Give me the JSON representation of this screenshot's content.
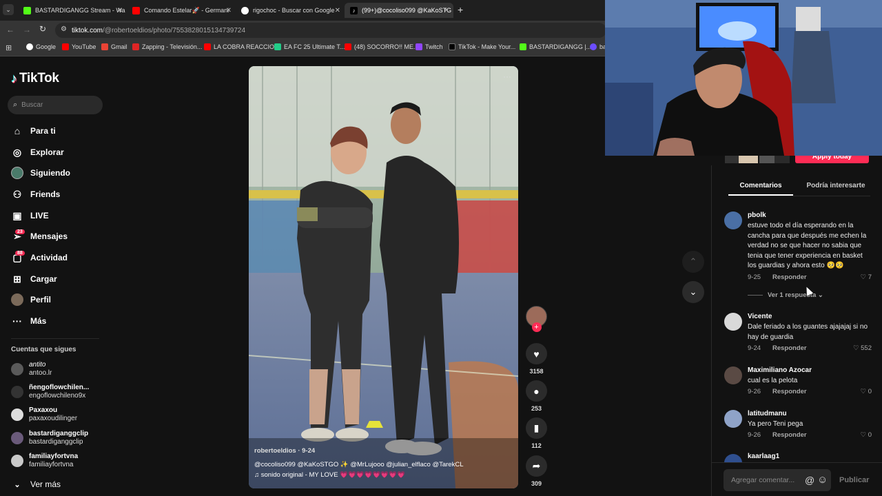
{
  "browser": {
    "tabs": [
      {
        "title": "BASTARDIGANGG Stream - Wa",
        "color": "#53fc18"
      },
      {
        "title": "Comando Estelar🚀 - Germani",
        "color": "#ff0000"
      },
      {
        "title": "rigochoc - Buscar con Google",
        "color": "#4285f4"
      },
      {
        "title": "(99+)@cocoliso099 @KaKoSTG",
        "color": "#000000"
      }
    ],
    "new_tab": "+",
    "url_host": "tiktok.com",
    "url_path": "/@robertoeldios/photo/7553828015134739724",
    "bookmarks": [
      {
        "label": "Google",
        "color": "#4285f4"
      },
      {
        "label": "YouTube",
        "color": "#ff0000"
      },
      {
        "label": "Gmail",
        "color": "#ea4335"
      },
      {
        "label": "Zapping - Televisión...",
        "color": "#e02525"
      },
      {
        "label": "LA COBRA REACCIO...",
        "color": "#ff0000"
      },
      {
        "label": "EA FC 25 Ultimate T...",
        "color": "#22cc88"
      },
      {
        "label": "(48) SOCORRO!! ME...",
        "color": "#ff0000"
      },
      {
        "label": "Twitch",
        "color": "#9146ff"
      },
      {
        "label": "TikTok - Make Your...",
        "color": "#000000"
      },
      {
        "label": "BASTARDIGANGG |...",
        "color": "#53fc18"
      },
      {
        "label": "ba",
        "color": "#6c4dff"
      }
    ]
  },
  "sidebar": {
    "logo": "TikTok",
    "search_placeholder": "Buscar",
    "nav": [
      {
        "label": "Para ti",
        "icon": "home-icon"
      },
      {
        "label": "Explorar",
        "icon": "compass-icon"
      },
      {
        "label": "Siguiendo",
        "icon": "following-avatar"
      },
      {
        "label": "Friends",
        "icon": "friends-icon"
      },
      {
        "label": "LIVE",
        "icon": "live-icon"
      },
      {
        "label": "Mensajes",
        "icon": "messages-icon",
        "badge": "23"
      },
      {
        "label": "Actividad",
        "icon": "activity-icon",
        "badge": "88"
      },
      {
        "label": "Cargar",
        "icon": "upload-icon"
      },
      {
        "label": "Perfil",
        "icon": "profile-avatar"
      },
      {
        "label": "Más",
        "icon": "more-icon"
      }
    ],
    "following_title": "Cuentas que sigues",
    "following": [
      {
        "name": "antito",
        "handle": "antoo.lr"
      },
      {
        "name": "ñengoflowchilen...",
        "handle": "engoflowchileno9x"
      },
      {
        "name": "Paxaxou",
        "handle": "paxaxoudilinger"
      },
      {
        "name": "bastardiganggclip",
        "handle": "bastardiganggclip"
      },
      {
        "name": "familiayfortvna",
        "handle": "familiayfortvna"
      }
    ],
    "see_more": "Ver más"
  },
  "video": {
    "author": "robertoeldios · 9-24",
    "mentions": "@cocoliso099  @KaKoSTGO ✨  @MrLujooo  @julian_elflaco  @TarekCL",
    "sound": "♫ sonido original - MY LOVE 💗💗💗💗💗💗💗💗",
    "more": "···"
  },
  "actions": {
    "likes": "3158",
    "comments": "253",
    "saves": "112",
    "shares": "309"
  },
  "panel": {
    "apply_button": "Apply today",
    "tab_comments": "Comentarios",
    "tab_interest": "Podría interesarte",
    "comments": [
      {
        "user": "pbolk",
        "text": "estuve todo el día esperando en la cancha para que después me echen la verdad no se que hacer no sabia que tenia que tener experiencia en basket los guardias y ahora esto 🥺🥺",
        "date": "9-25",
        "reply": "Responder",
        "likes": "7",
        "view_replies": "Ver 1 respuesta"
      },
      {
        "user": "Vicente",
        "text": "Dale feriado a los guantes ajajajaj si no hay de guardia",
        "date": "9-24",
        "reply": "Responder",
        "likes": "552"
      },
      {
        "user": "Maximiliano Azocar",
        "text": "cual es la pelota",
        "date": "9-26",
        "reply": "Responder",
        "likes": "0"
      },
      {
        "user": "latitudmanu",
        "text": "Ya pero Teni pega",
        "date": "9-26",
        "reply": "Responder",
        "likes": "0"
      },
      {
        "user": "kaarlaag1",
        "text": "",
        "date": "",
        "reply": "",
        "likes": ""
      }
    ],
    "add_comment_placeholder": "Agregar comentar...",
    "mention": "@",
    "emoji": "☺",
    "publish": "Publicar"
  },
  "colors": {
    "accent": "#fe2c55",
    "bg": "#121212"
  }
}
